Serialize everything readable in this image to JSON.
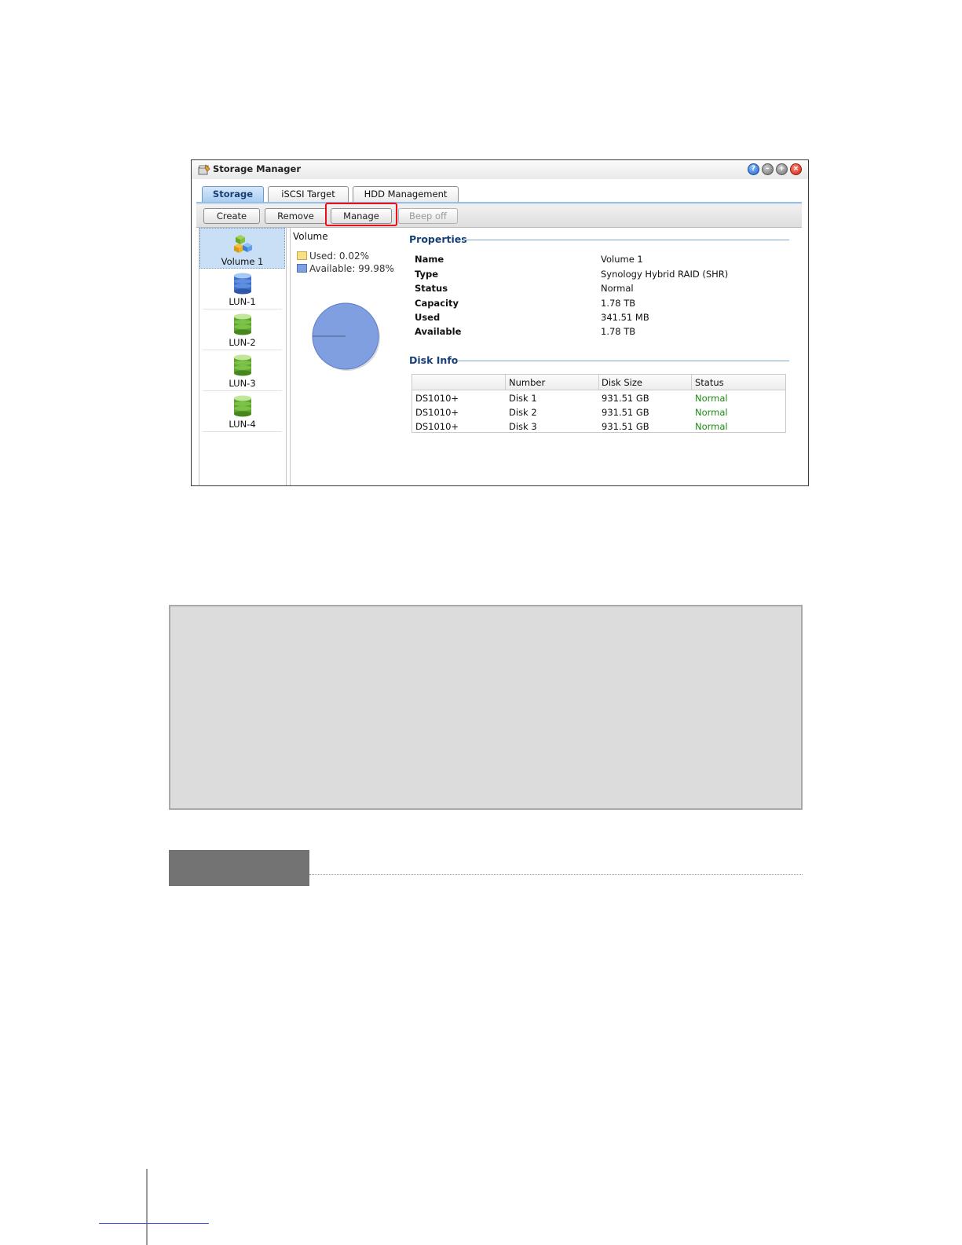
{
  "window": {
    "title": "Storage Manager",
    "controls": [
      "help-icon",
      "minimize-icon",
      "maximize-icon",
      "close-icon"
    ]
  },
  "tabs": [
    {
      "label": "Storage",
      "active": true
    },
    {
      "label": "iSCSI Target",
      "active": false
    },
    {
      "label": "HDD Management",
      "active": false
    }
  ],
  "toolbar": {
    "create": "Create",
    "remove": "Remove",
    "manage": "Manage",
    "beep_off": "Beep off"
  },
  "left_panel": {
    "items": [
      {
        "label": "Volume 1",
        "icon": "volume-icon",
        "selected": true
      },
      {
        "label": "LUN-1",
        "icon": "lun-blue-icon",
        "selected": false
      },
      {
        "label": "LUN-2",
        "icon": "lun-green-icon",
        "selected": false
      },
      {
        "label": "LUN-3",
        "icon": "lun-green-icon",
        "selected": false
      },
      {
        "label": "LUN-4",
        "icon": "lun-green-icon",
        "selected": false
      }
    ]
  },
  "volume_chart": {
    "title": "Volume",
    "used_label": "Used: 0.02%",
    "available_label": "Available: 99.98%",
    "used_percent": 0.02,
    "available_percent": 99.98,
    "used_color": "#f7e08a",
    "available_color": "#7f9fe0"
  },
  "properties": {
    "title": "Properties",
    "rows": [
      {
        "label": "Name",
        "value": "Volume 1"
      },
      {
        "label": "Type",
        "value": "Synology Hybrid RAID (SHR)"
      },
      {
        "label": "Status",
        "value": "Normal"
      },
      {
        "label": "Capacity",
        "value": "1.78 TB"
      },
      {
        "label": "Used",
        "value": "341.51 MB"
      },
      {
        "label": "Available",
        "value": "1.78 TB"
      }
    ]
  },
  "disk_info": {
    "title": "Disk Info",
    "columns": [
      "",
      "Number",
      "Disk Size",
      "Status"
    ],
    "rows": [
      [
        "DS1010+",
        "Disk 1",
        "931.51 GB",
        "Normal"
      ],
      [
        "DS1010+",
        "Disk 2",
        "931.51 GB",
        "Normal"
      ],
      [
        "DS1010+",
        "Disk 3",
        "931.51 GB",
        "Normal"
      ]
    ],
    "status_color": "#1f8a14"
  },
  "highlight_color": "#e8101a"
}
